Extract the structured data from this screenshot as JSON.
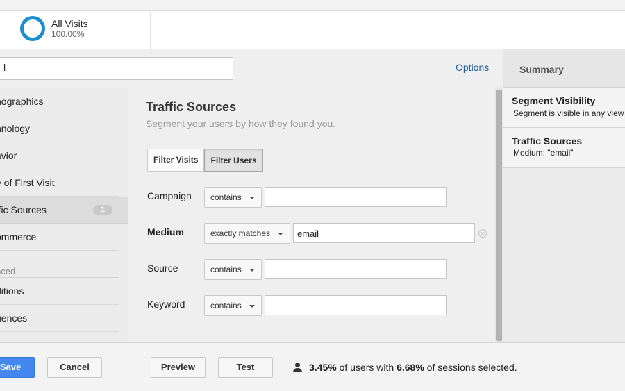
{
  "segment": {
    "title": "All Visits",
    "percent": "100.00%"
  },
  "editor": {
    "name_value": "l",
    "options_label": "Options"
  },
  "nav": {
    "items": [
      {
        "label": "nographics"
      },
      {
        "label": "hnology"
      },
      {
        "label": "avior"
      },
      {
        "label": "e of First Visit"
      },
      {
        "label": "ffic Sources",
        "badge": "1"
      },
      {
        "label": "ommerce"
      }
    ],
    "section_label": "nced",
    "advanced_items": [
      {
        "label": "ditions"
      },
      {
        "label": "uences"
      }
    ]
  },
  "panel": {
    "title": "Traffic Sources",
    "subtitle": "Segment your users by how they found you.",
    "toggle": {
      "visits": "Filter Visits",
      "users": "Filter Users"
    },
    "filters": [
      {
        "label": "Campaign",
        "operator": "contains",
        "value": ""
      },
      {
        "label": "Medium",
        "operator": "exactly matches",
        "value": "email"
      },
      {
        "label": "Source",
        "operator": "contains",
        "value": ""
      },
      {
        "label": "Keyword",
        "operator": "contains",
        "value": ""
      }
    ]
  },
  "summary": {
    "title": "Summary",
    "blocks": [
      {
        "heading": "Segment Visibility",
        "text": "Segment is visible in any view"
      },
      {
        "heading": "Traffic Sources",
        "text": "Medium: \"email\""
      }
    ]
  },
  "footer": {
    "save": "Save",
    "cancel": "Cancel",
    "preview": "Preview",
    "test": "Test",
    "users_pct": "3.45%",
    "of_users_with": " of users with ",
    "sessions_pct": "6.68%",
    "of_sessions_selected": " of sessions selected."
  },
  "colors": {
    "accent": "#1a8fd0",
    "primary_button": "#4487ee",
    "link": "#1b5a9a"
  }
}
